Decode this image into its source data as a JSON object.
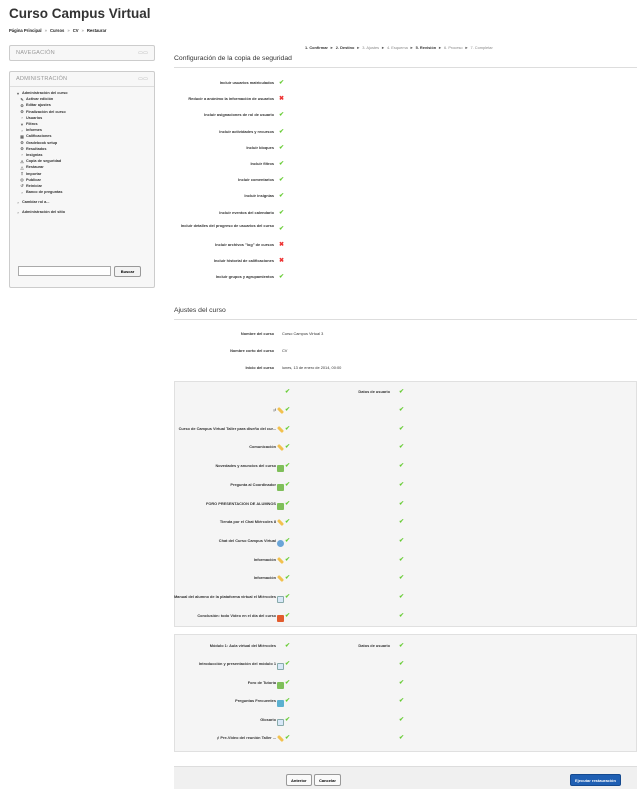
{
  "page": {
    "title": "Curso Campus Virtual"
  },
  "breadcrumb": [
    "Página Principal",
    "Cursos",
    "CV",
    "Restaurar"
  ],
  "blocks": {
    "navigation": {
      "title": "NAVEGACIÓN"
    },
    "administration": {
      "title": "ADMINISTRACIÓN",
      "course_admin": "Administración del curso",
      "items": [
        {
          "label": "Activar edición",
          "icon": "pencil-icon"
        },
        {
          "label": "Editar ajustes",
          "icon": "gear-icon"
        },
        {
          "label": "Finalización del curso",
          "icon": "gear-icon"
        },
        {
          "label": "Usuarios",
          "icon": "chevron-right-icon"
        },
        {
          "label": "Filtros",
          "icon": "filter-icon"
        },
        {
          "label": "Informes",
          "icon": "chevron-right-icon"
        },
        {
          "label": "Calificaciones",
          "icon": "grades-icon"
        },
        {
          "label": "Gradebook setup",
          "icon": "gear-icon"
        },
        {
          "label": "Resultados",
          "icon": "gear-icon"
        },
        {
          "label": "Insignias",
          "icon": "chevron-right-icon"
        },
        {
          "label": "Copia de seguridad",
          "icon": "backup-icon"
        },
        {
          "label": "Restaurar",
          "icon": "restore-icon"
        },
        {
          "label": "Importar",
          "icon": "import-icon"
        },
        {
          "label": "Publicar",
          "icon": "publish-icon"
        },
        {
          "label": "Reiniciar",
          "icon": "reset-icon"
        },
        {
          "label": "Banco de preguntas",
          "icon": "chevron-right-icon"
        }
      ],
      "switch_role": "Cambiar rol a...",
      "site_admin": "Administración del sitio",
      "search_button": "Buscar"
    }
  },
  "steps": {
    "items": [
      {
        "label": "1. Confirmar",
        "done": true
      },
      {
        "label": "2. Destino",
        "done": true
      },
      {
        "label": "3. Ajustes",
        "done": false
      },
      {
        "label": "4. Esquema",
        "done": false
      },
      {
        "label": "5. Revisión",
        "done": true
      },
      {
        "label": "6. Proceso",
        "done": false
      },
      {
        "label": "7. Completar",
        "done": false
      }
    ]
  },
  "backup_config": {
    "title": "Configuración de la copia de seguridad",
    "rows": [
      {
        "label": "Incluir usuarios matriculados",
        "status": "yes"
      },
      {
        "label": "Reducir a anónimo la información de usuarios",
        "status": "no"
      },
      {
        "label": "Incluir asignaciones de rol de usuario",
        "status": "yes"
      },
      {
        "label": "Incluir actividades y recursos",
        "status": "yes"
      },
      {
        "label": "Incluir bloques",
        "status": "yes"
      },
      {
        "label": "Incluir filtros",
        "status": "yes"
      },
      {
        "label": "Incluir comentarios",
        "status": "yes"
      },
      {
        "label": "Incluir insignias",
        "status": "yes"
      },
      {
        "label": "Incluir eventos del calendario",
        "status": "yes"
      },
      {
        "label": "Incluir detalles del progreso de usuarios del curso",
        "status": "yes"
      },
      {
        "label": "Incluir archivos \"log\" de cursos",
        "status": "no"
      },
      {
        "label": "Incluir historial de calificaciones",
        "status": "no"
      },
      {
        "label": "Incluir grupos y agrupamientos",
        "status": "yes"
      }
    ]
  },
  "course_settings": {
    "title": "Ajustes del curso",
    "rows": [
      {
        "label": "Nombre del curso",
        "value": "Curso Campus Virtual 3"
      },
      {
        "label": "Nombre corto del curso",
        "value": "CV"
      },
      {
        "label": "Inicio del curso",
        "value": "lunes, 13 de enero de 2014, 00:00"
      }
    ]
  },
  "sections": {
    "general": {
      "column2_label": "Datos de usuario",
      "activities": [
        {
          "name": "",
          "icon": "none"
        },
        {
          "name": "¡!",
          "icon": "pencil"
        },
        {
          "name": "Curso de Campus Virtual Taller para diseño del cur...",
          "icon": "pencil"
        },
        {
          "name": "Comunicación",
          "icon": "pencil"
        },
        {
          "name": "Novedades y anuncios del curso",
          "icon": "forum"
        },
        {
          "name": "Pregunta al Coordinador",
          "icon": "forum"
        },
        {
          "name": "FORO PRESENTACION DE ALUMNOS",
          "icon": "forum"
        },
        {
          "name": "Tienda por el Chat Miércoles 8",
          "icon": "pencil"
        },
        {
          "name": "Chat del Curso Campus Virtual",
          "icon": "chat"
        },
        {
          "name": "Información",
          "icon": "pencil"
        },
        {
          "name": "Información",
          "icon": "pencil"
        },
        {
          "name": "Manual del alumno de la plataforma virtual el Miércoles",
          "icon": "file"
        },
        {
          "name": "Conclusión: todo Vídeo en el día del curso",
          "icon": "hp"
        }
      ]
    },
    "module1": {
      "column1_label": "Módulo 1: Aula virtual del Miércoles",
      "column2_label": "Datos de usuario",
      "activities": [
        {
          "name": "Introducción y presentación del módulo 1",
          "icon": "file"
        },
        {
          "name": "Foro de Tutoría",
          "icon": "forum"
        },
        {
          "name": "Preguntas Frecuentes",
          "icon": "quiz"
        },
        {
          "name": "Glosario",
          "icon": "file"
        },
        {
          "name": "¡! Pre-Video del reunión Taller ...",
          "icon": "pencil"
        }
      ]
    }
  },
  "footer": {
    "previous": "Anterior",
    "cancel": "Cancelar",
    "execute": "Ejecutar restauración"
  },
  "colors": {
    "check": "#66cc33",
    "cross": "#ee3333",
    "primary": "#1f5fb3"
  }
}
